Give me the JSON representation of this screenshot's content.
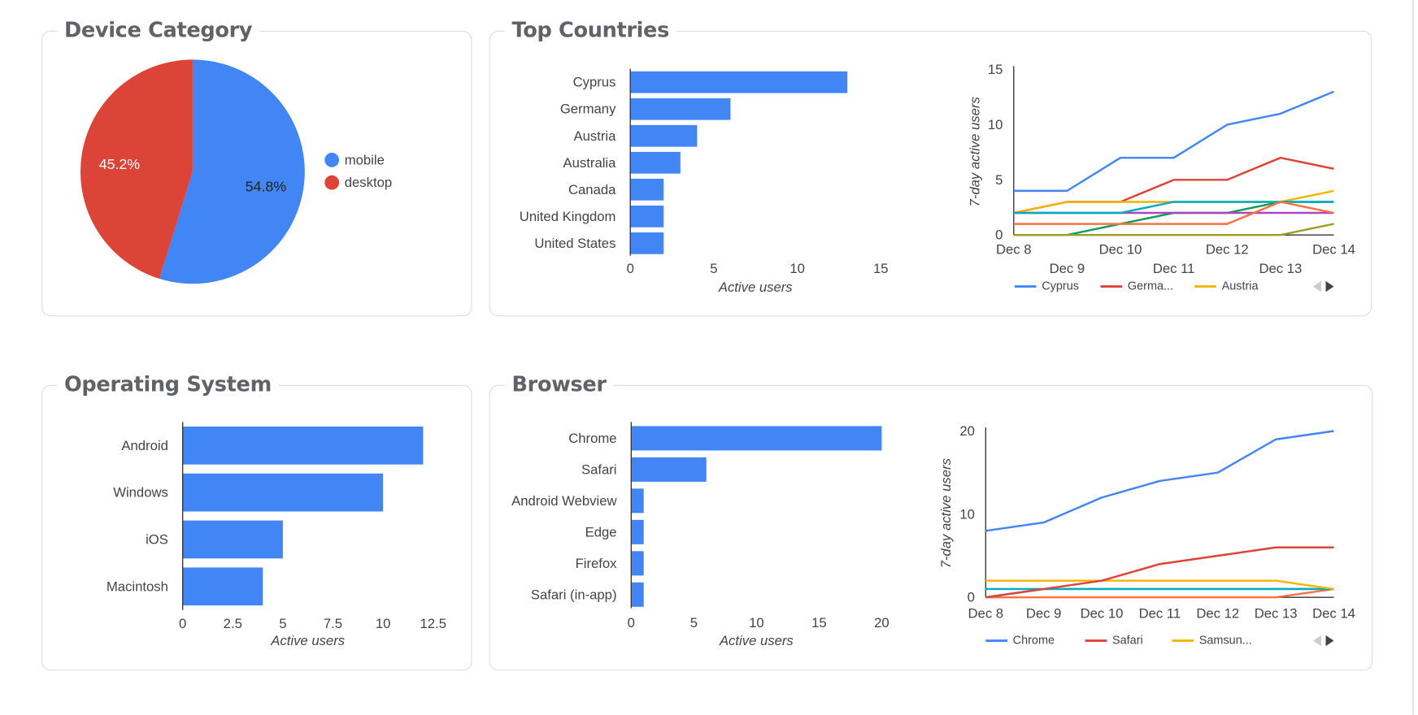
{
  "cards": {
    "device": {
      "title": "Device Category"
    },
    "countries": {
      "title": "Top Countries"
    },
    "os": {
      "title": "Operating System"
    },
    "browser": {
      "title": "Browser"
    }
  },
  "chart_data": [
    {
      "id": "device-pie",
      "type": "pie",
      "categories": [
        "mobile",
        "desktop"
      ],
      "values": [
        54.8,
        45.2
      ],
      "data_labels": [
        "54.8%",
        "45.2%"
      ],
      "colors": [
        "#4285f4",
        "#db4437"
      ],
      "legend": "right"
    },
    {
      "id": "countries-bar",
      "type": "bar",
      "orientation": "horizontal",
      "categories": [
        "Cyprus",
        "Germany",
        "Austria",
        "Australia",
        "Canada",
        "United Kingdom",
        "United States"
      ],
      "values": [
        13,
        6,
        4,
        3,
        2,
        2,
        2
      ],
      "xlabel": "Active users",
      "xlim": [
        0,
        15
      ],
      "xticks": [
        "0",
        "5",
        "10",
        "15"
      ],
      "color": "#4285f4"
    },
    {
      "id": "countries-line",
      "type": "line",
      "x": [
        "Dec 8",
        "Dec 9",
        "Dec 10",
        "Dec 11",
        "Dec 12",
        "Dec 13",
        "Dec 14"
      ],
      "ylabel": "7-day active users",
      "ylim": [
        0,
        15
      ],
      "yticks": [
        "0",
        "5",
        "10",
        "15"
      ],
      "legend": "bottom",
      "legend_labels": [
        "Cyprus",
        "Germa...",
        "Austria"
      ],
      "series": [
        {
          "name": "Cyprus",
          "color": "#4285f4",
          "values": [
            4,
            4,
            7,
            7,
            10,
            11,
            13
          ]
        },
        {
          "name": "Germany",
          "color": "#db4437",
          "values": [
            2,
            3,
            3,
            5,
            5,
            7,
            6
          ]
        },
        {
          "name": "Austria",
          "color": "#f4b400",
          "values": [
            2,
            3,
            3,
            3,
            3,
            3,
            4
          ]
        },
        {
          "color": "#0f9d58",
          "values": [
            0,
            0,
            1,
            2,
            2,
            3,
            3
          ]
        },
        {
          "color": "#ab47bc",
          "values": [
            2,
            2,
            2,
            2,
            2,
            2,
            2
          ]
        },
        {
          "color": "#00acc1",
          "values": [
            2,
            2,
            2,
            3,
            3,
            3,
            3
          ]
        },
        {
          "color": "#ff7043",
          "values": [
            1,
            1,
            1,
            1,
            1,
            3,
            2
          ]
        },
        {
          "color": "#9e9d24",
          "values": [
            0,
            0,
            0,
            0,
            0,
            0,
            1
          ]
        }
      ]
    },
    {
      "id": "os-bar",
      "type": "bar",
      "orientation": "horizontal",
      "categories": [
        "Android",
        "Windows",
        "iOS",
        "Macintosh"
      ],
      "values": [
        12,
        10,
        5,
        4
      ],
      "xlabel": "Active users",
      "xlim": [
        0,
        12.5
      ],
      "xticks": [
        "0",
        "2.5",
        "5",
        "7.5",
        "10",
        "12.5"
      ],
      "color": "#4285f4"
    },
    {
      "id": "browser-bar",
      "type": "bar",
      "orientation": "horizontal",
      "categories": [
        "Chrome",
        "Safari",
        "Android Webview",
        "Edge",
        "Firefox",
        "Safari (in-app)"
      ],
      "values": [
        20,
        6,
        1,
        1,
        1,
        1
      ],
      "xlabel": "Active users",
      "xlim": [
        0,
        20
      ],
      "xticks": [
        "0",
        "5",
        "10",
        "15",
        "20"
      ],
      "color": "#4285f4"
    },
    {
      "id": "browser-line",
      "type": "line",
      "x": [
        "Dec 8",
        "Dec 9",
        "Dec 10",
        "Dec 11",
        "Dec 12",
        "Dec 13",
        "Dec 14"
      ],
      "ylabel": "7-day active users",
      "ylim": [
        0,
        20
      ],
      "yticks": [
        "0",
        "10",
        "20"
      ],
      "legend": "bottom",
      "legend_labels": [
        "Chrome",
        "Safari",
        "Samsun..."
      ],
      "series": [
        {
          "color": "#ff7043",
          "values": [
            0,
            0,
            0,
            0,
            0,
            0,
            1
          ]
        },
        {
          "color": "#0f9d58",
          "values": [
            0,
            1,
            1,
            1,
            1,
            1,
            1
          ]
        },
        {
          "color": "#00acc1",
          "values": [
            1,
            1,
            1,
            1,
            1,
            1,
            1
          ]
        },
        {
          "name": "Samsung Internet",
          "color": "#f4b400",
          "values": [
            2,
            2,
            2,
            2,
            2,
            2,
            1
          ]
        },
        {
          "name": "Safari",
          "color": "#db4437",
          "values": [
            0,
            1,
            2,
            4,
            5,
            6,
            6
          ]
        },
        {
          "name": "Chrome",
          "color": "#4285f4",
          "values": [
            8,
            9,
            12,
            14,
            15,
            19,
            20
          ]
        }
      ]
    }
  ],
  "legend_nav": {
    "prev_icon": "triangle-left-icon",
    "next_icon": "triangle-right-icon"
  }
}
